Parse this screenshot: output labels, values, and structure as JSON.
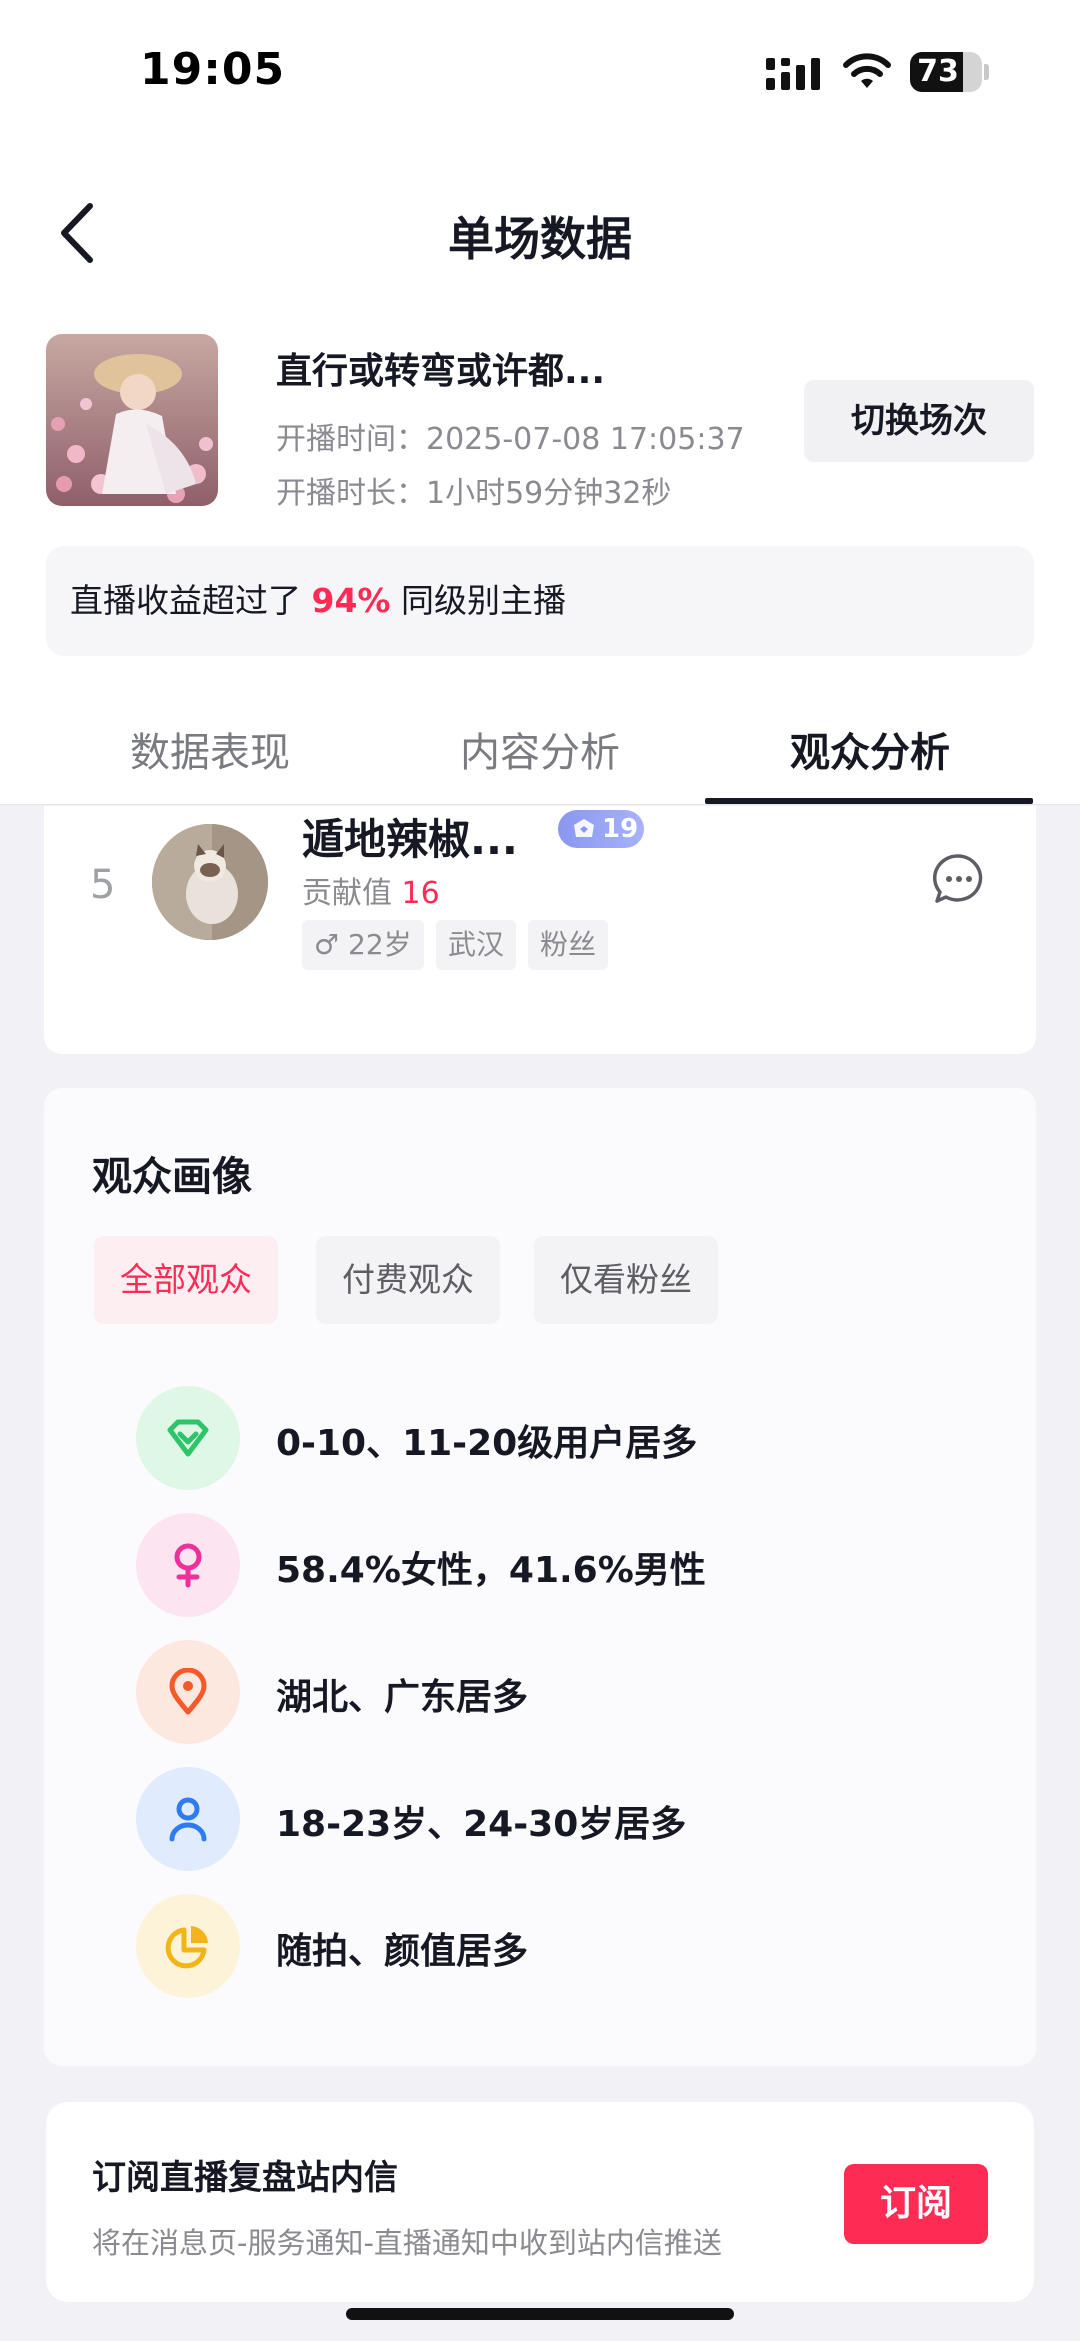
{
  "status_bar": {
    "time": "19:05",
    "battery": "73",
    "battery_level": 0.73
  },
  "header": {
    "title": "单场数据"
  },
  "live": {
    "title": "直行或转弯或许都...",
    "start_time": "开播时间：2025-07-08 17:05:37",
    "duration": "开播时长：1小时59分钟32秒",
    "switch_label": "切换场次"
  },
  "income": {
    "prefix": "直播收益超过了 ",
    "percent": "94%",
    "suffix": " 同级别主播"
  },
  "tabs": [
    {
      "label": "数据表现"
    },
    {
      "label": "内容分析"
    },
    {
      "label": "观众分析",
      "active": true
    }
  ],
  "ranking": {
    "rank": "5",
    "name": "遁地辣椒...",
    "level": "19",
    "contrib_label": "贡献值 ",
    "contrib_value": "16",
    "tags": [
      "♂ 22岁",
      "武汉",
      "粉丝"
    ]
  },
  "portrait": {
    "title": "观众画像",
    "filters": [
      "全部观众",
      "付费观众",
      "仅看粉丝"
    ],
    "stats": [
      {
        "icon": "diamond-icon",
        "color": "#2fc36a",
        "bg": "#dff7e5",
        "text": "0-10、11-20级用户居多"
      },
      {
        "icon": "female-icon",
        "color": "#f0309a",
        "bg": "#fde4f1",
        "text": "58.4%女性，41.6%男性"
      },
      {
        "icon": "location-icon",
        "color": "#f25a2b",
        "bg": "#fde8df",
        "text": "湖北、广东居多"
      },
      {
        "icon": "user-icon",
        "color": "#2f7cf0",
        "bg": "#e0ecfd",
        "text": "18-23岁、24-30岁居多"
      },
      {
        "icon": "pie-icon",
        "color": "#f3b419",
        "bg": "#fdf3d9",
        "text": "随拍、颜值居多"
      }
    ]
  },
  "subscribe": {
    "title": "订阅直播复盘站内信",
    "desc": "将在消息页-服务通知-直播通知中收到站内信推送",
    "button": "订阅"
  },
  "colors": {
    "accent": "#fe2c55",
    "text": "#161823",
    "muted": "#8a8b91"
  }
}
